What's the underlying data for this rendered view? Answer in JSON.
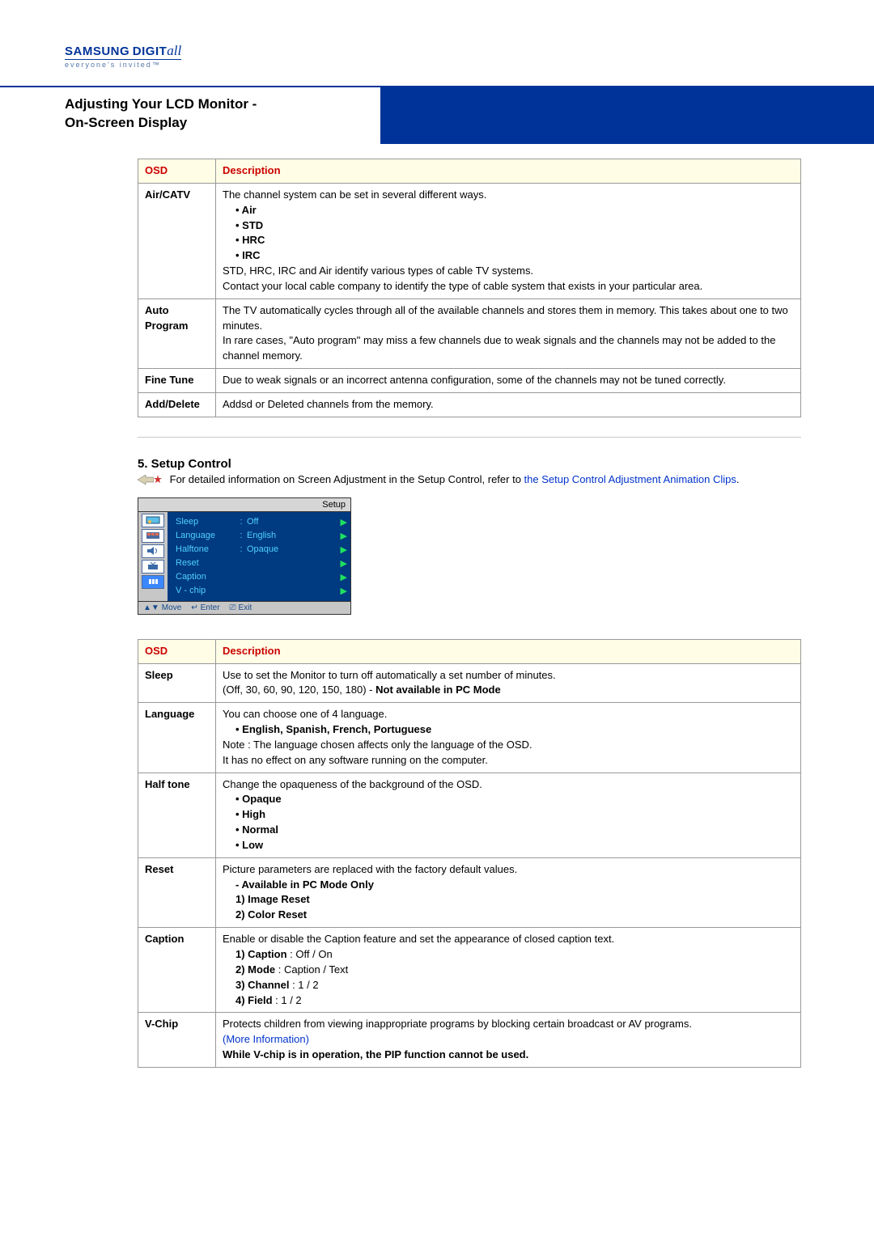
{
  "brand": {
    "name": "SAMSUNG",
    "suffix": "DIGIT",
    "italic": "all",
    "tagline": "everyone's invited™"
  },
  "page_title_line1": "Adjusting Your LCD Monitor  -",
  "page_title_line2": "On-Screen Display",
  "table1": {
    "head_osd": "OSD",
    "head_desc": "Description",
    "rows": [
      {
        "osd": "Air/CATV",
        "lines": [
          "The channel system can be set in several different ways.",
          "• Air",
          "• STD",
          "• HRC",
          "• IRC",
          "STD, HRC, IRC and Air identify various types of cable TV systems.",
          "Contact your local cable company to identify the type of cable system that exists in your particular area."
        ]
      },
      {
        "osd": "Auto Program",
        "lines": [
          "The TV automatically cycles through all of the available channels and stores them in memory. This takes about one to two minutes.",
          "In rare cases, \"Auto program\" may miss a few channels due to weak signals and the channels may not be added to the channel memory."
        ]
      },
      {
        "osd": "Fine Tune",
        "lines": [
          "Due to weak signals or an incorrect antenna configuration, some of the channels may not be tuned correctly."
        ]
      },
      {
        "osd": "Add/Delete",
        "lines": [
          "Addsd or Deleted channels from the memory."
        ]
      }
    ]
  },
  "setup": {
    "heading": "5. Setup Control",
    "lead_text": "For detailed information on Screen Adjustment in the Setup Control, refer to ",
    "lead_link": "the Setup Control Adjustment Animation Clips",
    "lead_after": "."
  },
  "osd_mock": {
    "title": "Setup",
    "items": [
      {
        "name": "Sleep",
        "val": "Off",
        "colon": ":"
      },
      {
        "name": "Language",
        "val": "English",
        "colon": ":"
      },
      {
        "name": "Halftone",
        "val": "Opaque",
        "colon": ":"
      },
      {
        "name": "Reset",
        "val": "",
        "colon": ""
      },
      {
        "name": "Caption",
        "val": "",
        "colon": ""
      },
      {
        "name": "V - chip",
        "val": "",
        "colon": ""
      }
    ],
    "hints": {
      "move": "Move",
      "enter": "Enter",
      "exit": "Exit"
    }
  },
  "table2": {
    "head_osd": "OSD",
    "head_desc": "Description",
    "rows": {
      "sleep": {
        "osd": "Sleep",
        "l1": "Use to set the Monitor to turn off automatically a set number of minutes.",
        "l2a": "(Off, 30, 60, 90, 120, 150, 180) - ",
        "l2b": "Not available in PC Mode"
      },
      "language": {
        "osd": "Language",
        "l1": "You can choose one of 4 language.",
        "l2": "• English, Spanish, French, Portuguese",
        "l3": "Note : The language chosen affects only the language of the OSD.",
        "l4": "It has no effect on any software running on the computer."
      },
      "halftone": {
        "osd": "Half tone",
        "l1": "Change the opaqueness of the background of the OSD.",
        "b1": "• Opaque",
        "b2": "• High",
        "b3": "• Normal",
        "b4": "• Low"
      },
      "reset": {
        "osd": "Reset",
        "l1": "Picture parameters are replaced with the factory default values.",
        "b1": "- Available in PC Mode Only",
        "b2": "1) Image Reset",
        "b3": "2) Color Reset"
      },
      "caption": {
        "osd": "Caption",
        "l1": "Enable or disable the Caption feature and set the appearance of closed caption text.",
        "b1": "1) Caption",
        "b1v": " : Off / On",
        "b2": "2) Mode",
        "b2v": " : Caption / Text",
        "b3": "3) Channel",
        "b3v": " : 1 / 2",
        "b4": "4) Field",
        "b4v": " : 1 / 2"
      },
      "vchip": {
        "osd": "V-Chip",
        "l1": "Protects children from viewing inappropriate programs by blocking certain broadcast or AV programs.",
        "link": "(More Information)",
        "l2": "While V-chip is in operation, the PIP function cannot be used."
      }
    }
  }
}
